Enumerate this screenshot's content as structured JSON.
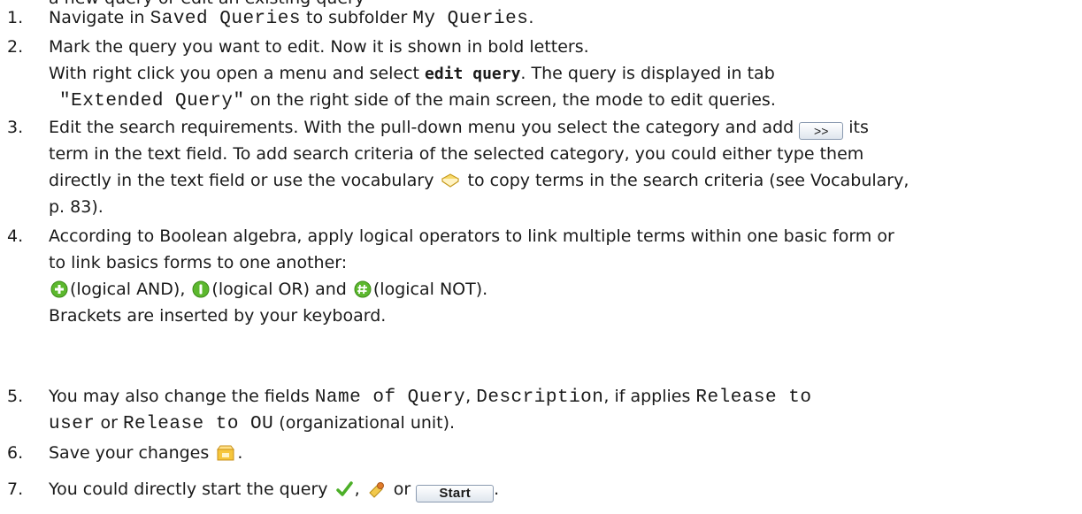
{
  "top_partial": "a new query or edit an existing query",
  "steps": [
    {
      "num": "1.",
      "lines": [
        {
          "a": "Navigate in ",
          "m1": "Saved Queries",
          "b": " to subfolder ",
          "m2": "My Queries",
          "c": "."
        }
      ]
    },
    {
      "num": "2.",
      "lines": [
        "Mark the query you want to edit. Now it is shown in bold letters.",
        {
          "a": "With right click you open a menu and select ",
          "b": "edit query",
          "c": ". The query is displayed in tab"
        },
        {
          "m": "\"Extended Query\"",
          "c": " on the right side of the main screen, the mode to edit queries."
        }
      ]
    },
    {
      "num": "3.",
      "lines": [
        {
          "a": "Edit the search requirements. With the pull-down menu you select the category and add ",
          "btn": ">>",
          "c": " its"
        },
        "term in the text field. To add search criteria of the selected category, you could either type them",
        {
          "a": "directly in the text field or use the vocabulary ",
          "c": " to copy terms in the search criteria (see Vocabulary,"
        },
        "p. 83)."
      ]
    },
    {
      "num": "4.",
      "lines": [
        "According to Boolean algebra, apply logical operators to link multiple terms within one basic form or",
        "to link basics forms to one another:",
        {
          "and": "(logical AND), ",
          "or": "(logical OR) and ",
          "not": "(logical NOT)."
        },
        "Brackets are inserted by your keyboard."
      ]
    },
    {
      "num": "5.",
      "lines": [
        {
          "a": "You may also change the fields ",
          "m1": "Name of Query",
          "b": ", ",
          "m2": "Description",
          "c": ", if applies ",
          "m3": "Release to"
        },
        {
          "m1": "user",
          "b": " or ",
          "m2": "Release to OU",
          "c": " (organizational unit)."
        }
      ]
    },
    {
      "num": "6.",
      "lines": [
        {
          "a": "Save your changes ",
          "c": "."
        }
      ]
    },
    {
      "num": "7.",
      "lines": [
        {
          "a": "You could directly start the query ",
          "b": ", ",
          "c": " or ",
          "btn": "Start",
          "d": "."
        }
      ]
    }
  ],
  "icons": {
    "add": "add-button-icon",
    "vocabulary": "vocabulary-book-icon",
    "and": "logical-and-icon",
    "or": "logical-or-icon",
    "not": "logical-not-icon",
    "save": "save-icon",
    "check": "checkmark-icon",
    "search": "search-run-icon"
  },
  "colors": {
    "green": "#5cb82e",
    "yellow": "#f4c51f"
  }
}
